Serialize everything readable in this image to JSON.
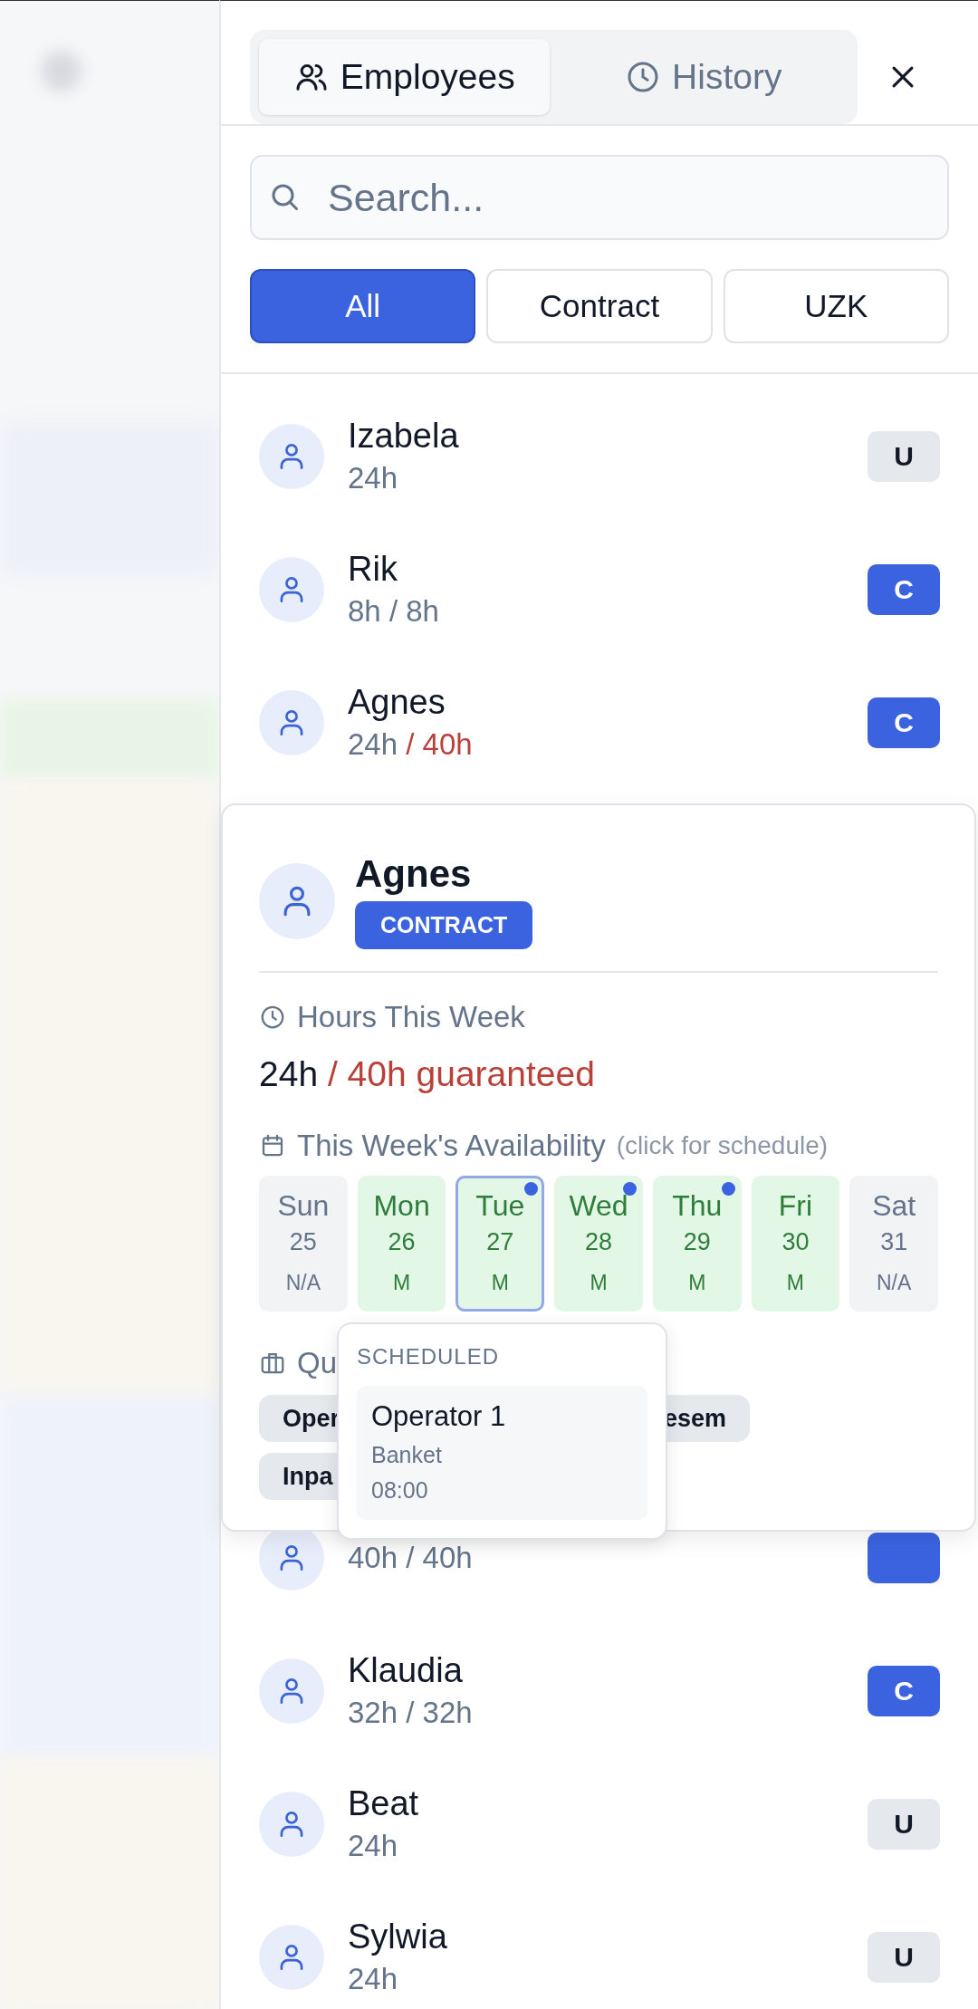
{
  "tabs": [
    {
      "label": "Employees",
      "selected": true
    },
    {
      "label": "History",
      "selected": false
    }
  ],
  "search": {
    "placeholder": "Search..."
  },
  "filters": [
    {
      "label": "All",
      "selected": true
    },
    {
      "label": "Contract",
      "selected": false
    },
    {
      "label": "UZK",
      "selected": false
    }
  ],
  "employees": [
    {
      "name": "Izabela",
      "hours": "24h",
      "kind": "uzk",
      "badge": "U"
    },
    {
      "name": "Rik",
      "hours": "8h",
      "target": "/ 8h",
      "short": false,
      "kind": "contract",
      "badge": "C"
    },
    {
      "name": "Agnes",
      "hours": "24h",
      "target": "/ 40h",
      "short": true,
      "kind": "contract",
      "badge": "C"
    },
    {
      "hours": "40h",
      "target": "/ 40h",
      "short": false,
      "kind": "contract"
    },
    {
      "name": "Klaudia",
      "hours": "32h",
      "target": "/ 32h",
      "short": false,
      "kind": "contract",
      "badge": "C"
    },
    {
      "name": "Beat",
      "hours": "24h",
      "kind": "uzk",
      "badge": "U"
    },
    {
      "name": "Sylwia",
      "hours": "24h",
      "kind": "uzk",
      "badge": "U"
    }
  ],
  "detail": {
    "name": "Agnes",
    "type_label": "CONTRACT",
    "hours_title": "Hours This Week",
    "hours": "24h",
    "guarantee": "/ 40h guaranteed",
    "short": true,
    "availability_title": "This Week's Availability",
    "availability_hint": "(click for schedule)",
    "days": [
      {
        "day": "Sun",
        "date": "25",
        "shift": "N/A",
        "available": false,
        "selected": false,
        "scheduled": false
      },
      {
        "day": "Mon",
        "date": "26",
        "shift": "M",
        "available": true,
        "selected": false,
        "scheduled": false
      },
      {
        "day": "Tue",
        "date": "27",
        "shift": "M",
        "available": true,
        "selected": true,
        "scheduled": true
      },
      {
        "day": "Wed",
        "date": "28",
        "shift": "M",
        "available": true,
        "selected": false,
        "scheduled": true
      },
      {
        "day": "Thu",
        "date": "29",
        "shift": "M",
        "available": true,
        "selected": false,
        "scheduled": true
      },
      {
        "day": "Fri",
        "date": "30",
        "shift": "M",
        "available": true,
        "selected": false,
        "scheduled": false
      },
      {
        "day": "Sat",
        "date": "31",
        "shift": "N/A",
        "available": false,
        "selected": false,
        "scheduled": false
      }
    ],
    "qualifications_title": "Qu",
    "qualifications": [
      {
        "label": "Oper"
      },
      {
        "label": "esem"
      },
      {
        "label": "Inpa"
      }
    ]
  },
  "tooltip": {
    "title": "SCHEDULED",
    "shift": "Operator 1",
    "location": "Banket",
    "time": "08:00"
  }
}
